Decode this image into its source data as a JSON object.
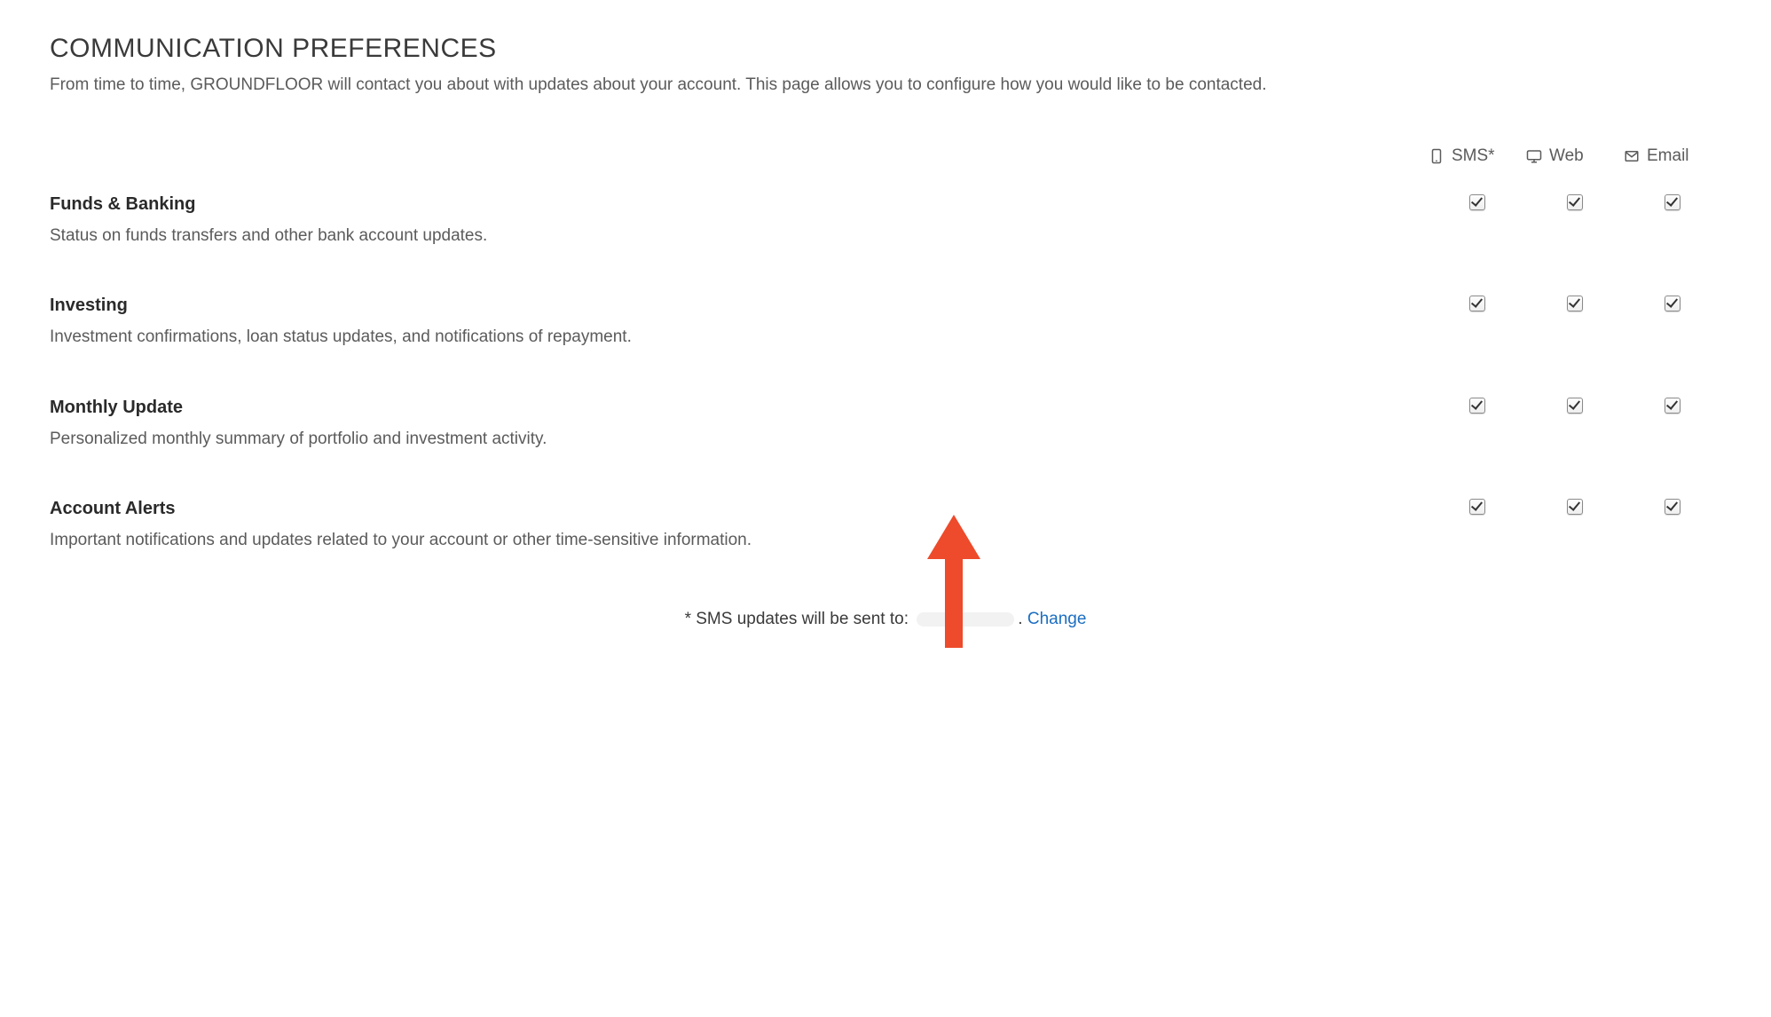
{
  "page": {
    "title": "COMMUNICATION PREFERENCES",
    "subtitle": "From time to time, GROUNDFLOOR will contact you about with updates about your account. This page allows you to configure how you would like to be contacted."
  },
  "channels": {
    "sms": "SMS*",
    "web": "Web",
    "email": "Email"
  },
  "rows": [
    {
      "title": "Funds & Banking",
      "desc": "Status on funds transfers and other bank account updates.",
      "sms": true,
      "web": true,
      "email": true
    },
    {
      "title": "Investing",
      "desc": "Investment confirmations, loan status updates, and notifications of repayment.",
      "sms": true,
      "web": true,
      "email": true
    },
    {
      "title": "Monthly Update",
      "desc": "Personalized monthly summary of portfolio and investment activity.",
      "sms": true,
      "web": true,
      "email": true
    },
    {
      "title": "Account Alerts",
      "desc": "Important notifications and updates related to your account or other time-sensitive information.",
      "sms": true,
      "web": true,
      "email": true
    }
  ],
  "sms_note": {
    "prefix": "* SMS updates will be sent to:",
    "suffix_punct": ". ",
    "change_label": "Change"
  }
}
